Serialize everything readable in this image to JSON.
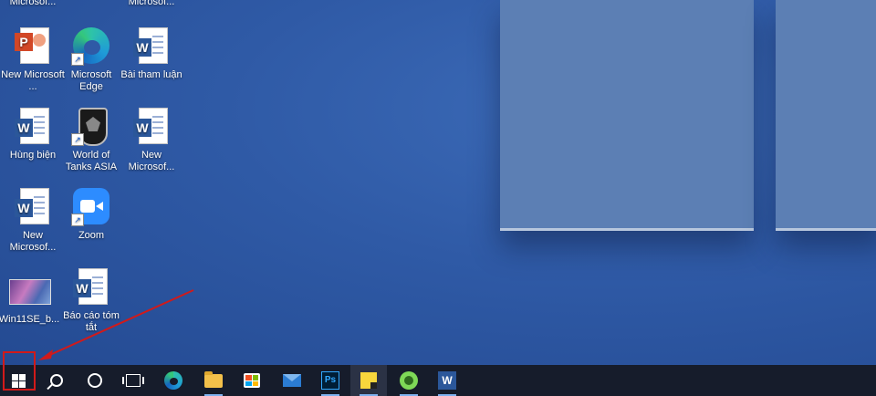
{
  "desktop": {
    "top_labels": {
      "col1": "Microsof...",
      "col2": "Microsof..."
    },
    "icons": [
      {
        "label": "New Microsoft ...",
        "icon": "powerpoint-file-icon"
      },
      {
        "label": "Microsoft Edge",
        "icon": "edge-icon"
      },
      {
        "label": "Bài tham luận",
        "icon": "word-file-icon"
      },
      {
        "label": "Hùng biện",
        "icon": "word-file-icon"
      },
      {
        "label": "World of Tanks ASIA",
        "icon": "world-of-tanks-icon"
      },
      {
        "label": "New Microsof...",
        "icon": "word-file-icon"
      },
      {
        "label": "New Microsof...",
        "icon": "word-file-icon"
      },
      {
        "label": "Zoom",
        "icon": "zoom-icon"
      },
      {
        "label": "Win11SE_b...",
        "icon": "image-file-icon"
      },
      {
        "label": "Báo cáo tóm tắt",
        "icon": "word-file-icon"
      }
    ]
  },
  "taskbar": {
    "buttons": [
      {
        "name": "start",
        "icon": "windows-logo-icon"
      },
      {
        "name": "search",
        "icon": "search-icon"
      },
      {
        "name": "cortana",
        "icon": "cortana-circle-icon"
      },
      {
        "name": "task-view",
        "icon": "task-view-icon"
      },
      {
        "name": "edge",
        "icon": "edge-icon"
      },
      {
        "name": "file-explorer",
        "icon": "folder-icon"
      },
      {
        "name": "microsoft-store",
        "icon": "store-icon"
      },
      {
        "name": "mail",
        "icon": "mail-icon"
      },
      {
        "name": "photoshop",
        "icon": "photoshop-icon",
        "text": "Ps"
      },
      {
        "name": "sticky-notes",
        "icon": "sticky-notes-icon"
      },
      {
        "name": "greenshot",
        "icon": "greenshot-icon"
      },
      {
        "name": "word",
        "icon": "word-icon",
        "text": "W"
      }
    ]
  },
  "annotation": {
    "highlight_color": "#d11a1a"
  },
  "colors": {
    "desktop": "#2f5aa6",
    "taskbar": "#161c2b",
    "panel": "#5c7fb4"
  }
}
